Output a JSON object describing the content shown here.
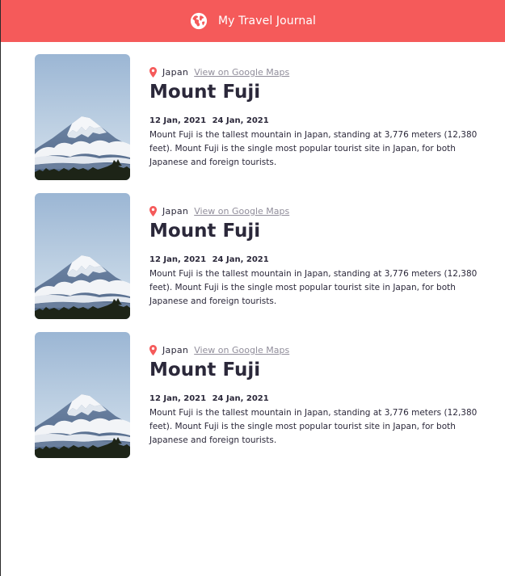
{
  "app": {
    "title": "My Travel Journal",
    "icon": "globe-icon",
    "accent_color": "#f55a5a"
  },
  "entries": [
    {
      "country": "Japan",
      "map_link_label": "View on Google Maps",
      "place": "Mount Fuji",
      "start_date": "12 Jan, 2021",
      "end_date": "24 Jan, 2021",
      "description": "Mount Fuji is the tallest mountain in Japan, standing at 3,776 meters (12,380 feet). Mount Fuji is the single most popular tourist site in Japan, for both Japanese and foreign tourists.",
      "image": "mount-fuji-photo"
    },
    {
      "country": "Japan",
      "map_link_label": "View on Google Maps",
      "place": "Mount Fuji",
      "start_date": "12 Jan, 2021",
      "end_date": "24 Jan, 2021",
      "description": "Mount Fuji is the tallest mountain in Japan, standing at 3,776 meters (12,380 feet). Mount Fuji is the single most popular tourist site in Japan, for both Japanese and foreign tourists.",
      "image": "mount-fuji-photo"
    },
    {
      "country": "Japan",
      "map_link_label": "View on Google Maps",
      "place": "Mount Fuji",
      "start_date": "12 Jan, 2021",
      "end_date": "24 Jan, 2021",
      "description": "Mount Fuji is the tallest mountain in Japan, standing at 3,776 meters (12,380 feet). Mount Fuji is the single most popular tourist site in Japan, for both Japanese and foreign tourists.",
      "image": "mount-fuji-photo"
    }
  ]
}
